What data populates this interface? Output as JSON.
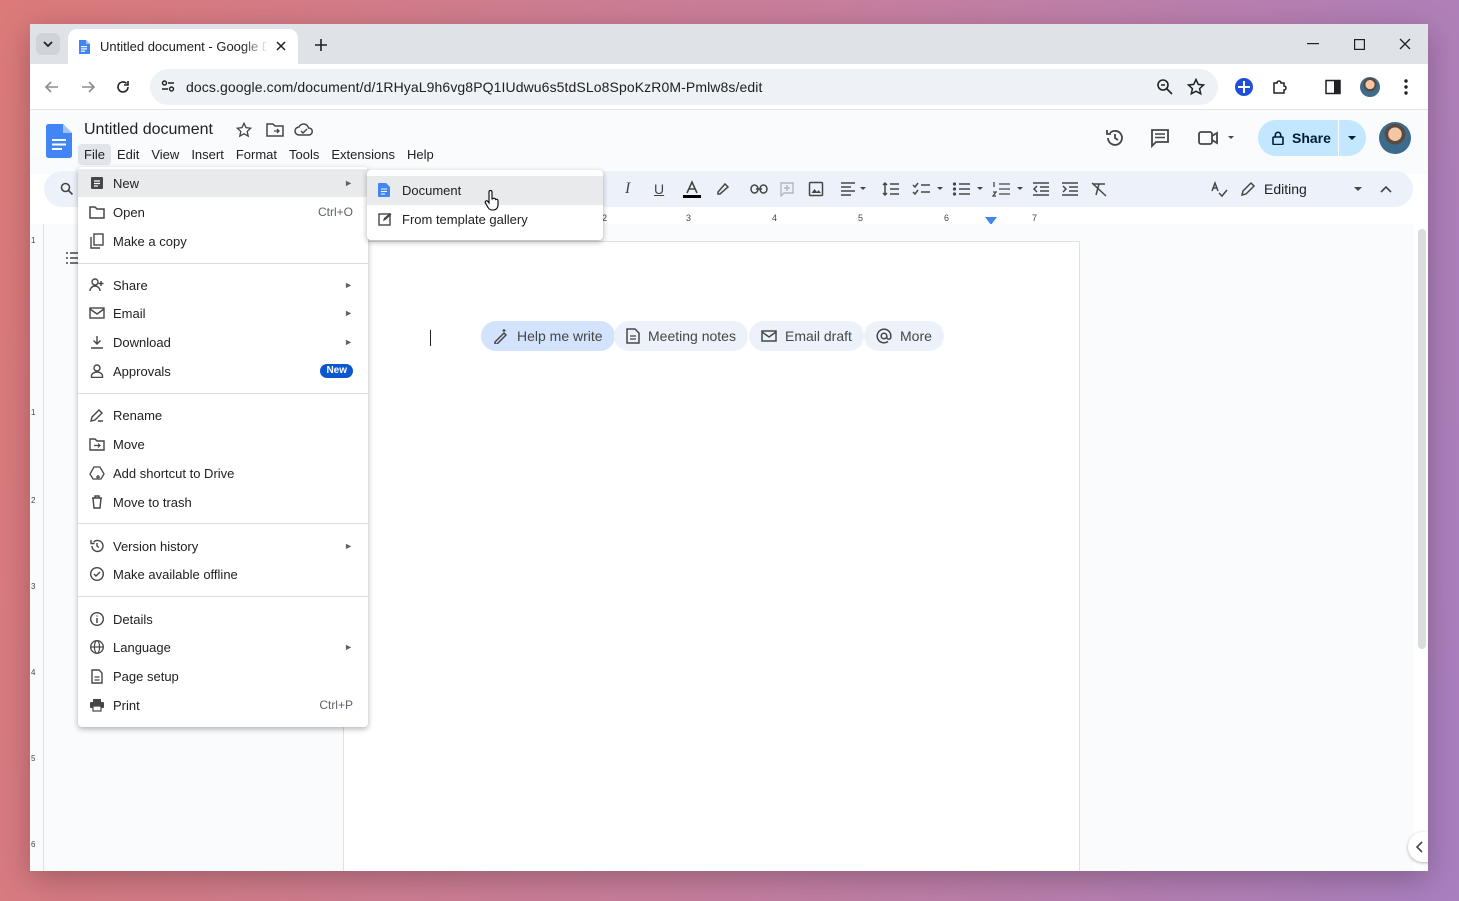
{
  "browser": {
    "tab_title": "Untitled document - Google Docs",
    "url": "docs.google.com/document/d/1RHyaL9h6vg8PQ1IUdwu6s5tdSLo8SpoKzR0M-Pmlw8s/edit"
  },
  "doc": {
    "title": "Untitled document",
    "menus": [
      "File",
      "Edit",
      "View",
      "Insert",
      "Format",
      "Tools",
      "Extensions",
      "Help"
    ],
    "share_label": "Share",
    "mode_label": "Editing"
  },
  "ruler": {
    "ticks": [
      "2",
      "3",
      "4",
      "5",
      "6",
      "7"
    ]
  },
  "vruler": {
    "ticks": [
      "1",
      "1",
      "2",
      "3",
      "4",
      "5",
      "6"
    ]
  },
  "chips": [
    "Help me write",
    "Meeting notes",
    "Email draft",
    "More"
  ],
  "file_menu": {
    "new": "New",
    "open": "Open",
    "open_shortcut": "Ctrl+O",
    "make_copy": "Make a copy",
    "share": "Share",
    "email": "Email",
    "download": "Download",
    "approvals": "Approvals",
    "approvals_badge": "New",
    "rename": "Rename",
    "move": "Move",
    "add_shortcut": "Add shortcut to Drive",
    "trash": "Move to trash",
    "version_history": "Version history",
    "offline": "Make available offline",
    "details": "Details",
    "language": "Language",
    "page_setup": "Page setup",
    "print": "Print",
    "print_shortcut": "Ctrl+P"
  },
  "new_submenu": {
    "document": "Document",
    "template": "From template gallery"
  },
  "colors": {
    "accent": "#0b57d0",
    "share_bg": "#c2e7ff",
    "docs_blue": "#4285f4"
  }
}
